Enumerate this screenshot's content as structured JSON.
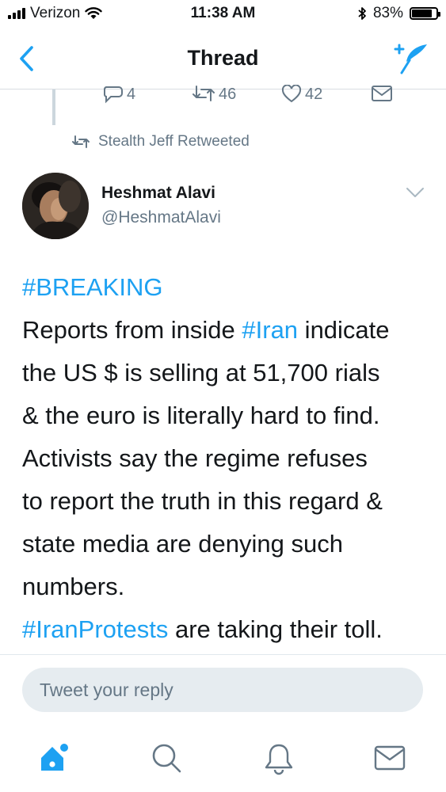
{
  "status": {
    "carrier": "Verizon",
    "time": "11:38 AM",
    "battery_percent_label": "83%",
    "battery_level": 0.83
  },
  "nav": {
    "title": "Thread"
  },
  "prev_tweet": {
    "reply_count": "4",
    "retweet_count": "46",
    "like_count": "42"
  },
  "retweet_context": {
    "text": "Stealth Jeff Retweeted",
    "icon": "retweet-icon"
  },
  "tweet": {
    "author_name": "Heshmat Alavi",
    "author_handle": "@HeshmatAlavi",
    "hashtag_breaking": "#BREAKING",
    "line2_prefix": "Reports from inside ",
    "hashtag_iran": "#Iran",
    "line2_suffix": " indicate",
    "line3": "the US $ is selling at 51,700 rials",
    "line4": "& the euro is literally hard to find.",
    "line5": "Activists say the regime refuses",
    "line6": "to report the truth in this regard &",
    "line7": "state media are denying such",
    "line8": "numbers.",
    "hashtag_protests": "#IranProtests",
    "line9_suffix": " are taking their toll."
  },
  "reply": {
    "placeholder": "Tweet your reply"
  },
  "tabs": [
    "home-icon",
    "search-icon",
    "notifications-bell-icon",
    "messages-envelope-icon"
  ],
  "colors": {
    "accent": "#1da1f2",
    "secondary_text": "#657786",
    "reply_bg": "#e6ecf0"
  }
}
